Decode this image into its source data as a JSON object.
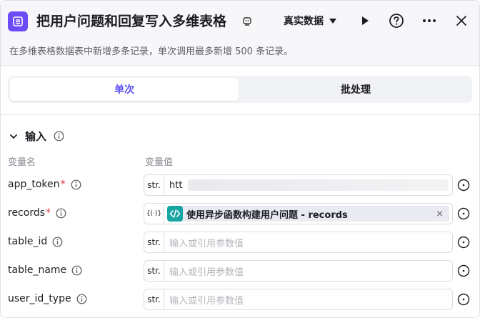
{
  "header": {
    "title": "把用户问题和回复写入多维表格",
    "mode_label": "真实数据",
    "description": "在多维表格数据表中新增多条记录，单次调用最多新增 500 条记录。"
  },
  "tabs": [
    {
      "label": "单次",
      "active": true
    },
    {
      "label": "批处理",
      "active": false
    }
  ],
  "section": {
    "title": "输入",
    "col_name": "变量名",
    "col_value": "变量值"
  },
  "params": [
    {
      "name": "app_token",
      "required": true,
      "type": "str.",
      "value": "htt",
      "placeholder": ""
    },
    {
      "name": "records",
      "required": true,
      "type": "{(·)}",
      "ref": "使用异步函数构建用户问题 - records"
    },
    {
      "name": "table_id",
      "required": false,
      "type": "str.",
      "placeholder": "输入或引用参数值"
    },
    {
      "name": "table_name",
      "required": false,
      "type": "str.",
      "placeholder": "输入或引用参数值"
    },
    {
      "name": "user_id_type",
      "required": false,
      "type": "str.",
      "placeholder": "输入或引用参数值"
    }
  ],
  "colors": {
    "accent": "#5b4cf5",
    "app_icon_bg": "#6b4cf6",
    "ref_icon_bg": "#16a5a3",
    "required": "#e0373f"
  },
  "icons": [
    "list-app-icon",
    "badge-icon",
    "play-icon",
    "help-icon",
    "more-icon",
    "close-icon",
    "chevron-down-icon",
    "info-icon",
    "code-icon",
    "reference-icon"
  ]
}
